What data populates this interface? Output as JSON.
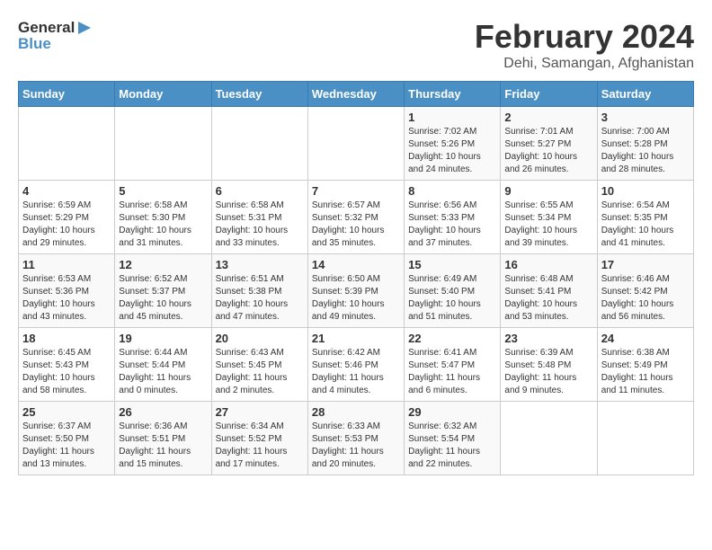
{
  "header": {
    "logo_general": "General",
    "logo_blue": "Blue",
    "title": "February 2024",
    "subtitle": "Dehi, Samangan, Afghanistan"
  },
  "weekdays": [
    "Sunday",
    "Monday",
    "Tuesday",
    "Wednesday",
    "Thursday",
    "Friday",
    "Saturday"
  ],
  "weeks": [
    [
      {
        "day": "",
        "sunrise": "",
        "sunset": "",
        "daylight": ""
      },
      {
        "day": "",
        "sunrise": "",
        "sunset": "",
        "daylight": ""
      },
      {
        "day": "",
        "sunrise": "",
        "sunset": "",
        "daylight": ""
      },
      {
        "day": "",
        "sunrise": "",
        "sunset": "",
        "daylight": ""
      },
      {
        "day": "1",
        "sunrise": "Sunrise: 7:02 AM",
        "sunset": "Sunset: 5:26 PM",
        "daylight": "Daylight: 10 hours and 24 minutes."
      },
      {
        "day": "2",
        "sunrise": "Sunrise: 7:01 AM",
        "sunset": "Sunset: 5:27 PM",
        "daylight": "Daylight: 10 hours and 26 minutes."
      },
      {
        "day": "3",
        "sunrise": "Sunrise: 7:00 AM",
        "sunset": "Sunset: 5:28 PM",
        "daylight": "Daylight: 10 hours and 28 minutes."
      }
    ],
    [
      {
        "day": "4",
        "sunrise": "Sunrise: 6:59 AM",
        "sunset": "Sunset: 5:29 PM",
        "daylight": "Daylight: 10 hours and 29 minutes."
      },
      {
        "day": "5",
        "sunrise": "Sunrise: 6:58 AM",
        "sunset": "Sunset: 5:30 PM",
        "daylight": "Daylight: 10 hours and 31 minutes."
      },
      {
        "day": "6",
        "sunrise": "Sunrise: 6:58 AM",
        "sunset": "Sunset: 5:31 PM",
        "daylight": "Daylight: 10 hours and 33 minutes."
      },
      {
        "day": "7",
        "sunrise": "Sunrise: 6:57 AM",
        "sunset": "Sunset: 5:32 PM",
        "daylight": "Daylight: 10 hours and 35 minutes."
      },
      {
        "day": "8",
        "sunrise": "Sunrise: 6:56 AM",
        "sunset": "Sunset: 5:33 PM",
        "daylight": "Daylight: 10 hours and 37 minutes."
      },
      {
        "day": "9",
        "sunrise": "Sunrise: 6:55 AM",
        "sunset": "Sunset: 5:34 PM",
        "daylight": "Daylight: 10 hours and 39 minutes."
      },
      {
        "day": "10",
        "sunrise": "Sunrise: 6:54 AM",
        "sunset": "Sunset: 5:35 PM",
        "daylight": "Daylight: 10 hours and 41 minutes."
      }
    ],
    [
      {
        "day": "11",
        "sunrise": "Sunrise: 6:53 AM",
        "sunset": "Sunset: 5:36 PM",
        "daylight": "Daylight: 10 hours and 43 minutes."
      },
      {
        "day": "12",
        "sunrise": "Sunrise: 6:52 AM",
        "sunset": "Sunset: 5:37 PM",
        "daylight": "Daylight: 10 hours and 45 minutes."
      },
      {
        "day": "13",
        "sunrise": "Sunrise: 6:51 AM",
        "sunset": "Sunset: 5:38 PM",
        "daylight": "Daylight: 10 hours and 47 minutes."
      },
      {
        "day": "14",
        "sunrise": "Sunrise: 6:50 AM",
        "sunset": "Sunset: 5:39 PM",
        "daylight": "Daylight: 10 hours and 49 minutes."
      },
      {
        "day": "15",
        "sunrise": "Sunrise: 6:49 AM",
        "sunset": "Sunset: 5:40 PM",
        "daylight": "Daylight: 10 hours and 51 minutes."
      },
      {
        "day": "16",
        "sunrise": "Sunrise: 6:48 AM",
        "sunset": "Sunset: 5:41 PM",
        "daylight": "Daylight: 10 hours and 53 minutes."
      },
      {
        "day": "17",
        "sunrise": "Sunrise: 6:46 AM",
        "sunset": "Sunset: 5:42 PM",
        "daylight": "Daylight: 10 hours and 56 minutes."
      }
    ],
    [
      {
        "day": "18",
        "sunrise": "Sunrise: 6:45 AM",
        "sunset": "Sunset: 5:43 PM",
        "daylight": "Daylight: 10 hours and 58 minutes."
      },
      {
        "day": "19",
        "sunrise": "Sunrise: 6:44 AM",
        "sunset": "Sunset: 5:44 PM",
        "daylight": "Daylight: 11 hours and 0 minutes."
      },
      {
        "day": "20",
        "sunrise": "Sunrise: 6:43 AM",
        "sunset": "Sunset: 5:45 PM",
        "daylight": "Daylight: 11 hours and 2 minutes."
      },
      {
        "day": "21",
        "sunrise": "Sunrise: 6:42 AM",
        "sunset": "Sunset: 5:46 PM",
        "daylight": "Daylight: 11 hours and 4 minutes."
      },
      {
        "day": "22",
        "sunrise": "Sunrise: 6:41 AM",
        "sunset": "Sunset: 5:47 PM",
        "daylight": "Daylight: 11 hours and 6 minutes."
      },
      {
        "day": "23",
        "sunrise": "Sunrise: 6:39 AM",
        "sunset": "Sunset: 5:48 PM",
        "daylight": "Daylight: 11 hours and 9 minutes."
      },
      {
        "day": "24",
        "sunrise": "Sunrise: 6:38 AM",
        "sunset": "Sunset: 5:49 PM",
        "daylight": "Daylight: 11 hours and 11 minutes."
      }
    ],
    [
      {
        "day": "25",
        "sunrise": "Sunrise: 6:37 AM",
        "sunset": "Sunset: 5:50 PM",
        "daylight": "Daylight: 11 hours and 13 minutes."
      },
      {
        "day": "26",
        "sunrise": "Sunrise: 6:36 AM",
        "sunset": "Sunset: 5:51 PM",
        "daylight": "Daylight: 11 hours and 15 minutes."
      },
      {
        "day": "27",
        "sunrise": "Sunrise: 6:34 AM",
        "sunset": "Sunset: 5:52 PM",
        "daylight": "Daylight: 11 hours and 17 minutes."
      },
      {
        "day": "28",
        "sunrise": "Sunrise: 6:33 AM",
        "sunset": "Sunset: 5:53 PM",
        "daylight": "Daylight: 11 hours and 20 minutes."
      },
      {
        "day": "29",
        "sunrise": "Sunrise: 6:32 AM",
        "sunset": "Sunset: 5:54 PM",
        "daylight": "Daylight: 11 hours and 22 minutes."
      },
      {
        "day": "",
        "sunrise": "",
        "sunset": "",
        "daylight": ""
      },
      {
        "day": "",
        "sunrise": "",
        "sunset": "",
        "daylight": ""
      }
    ]
  ]
}
